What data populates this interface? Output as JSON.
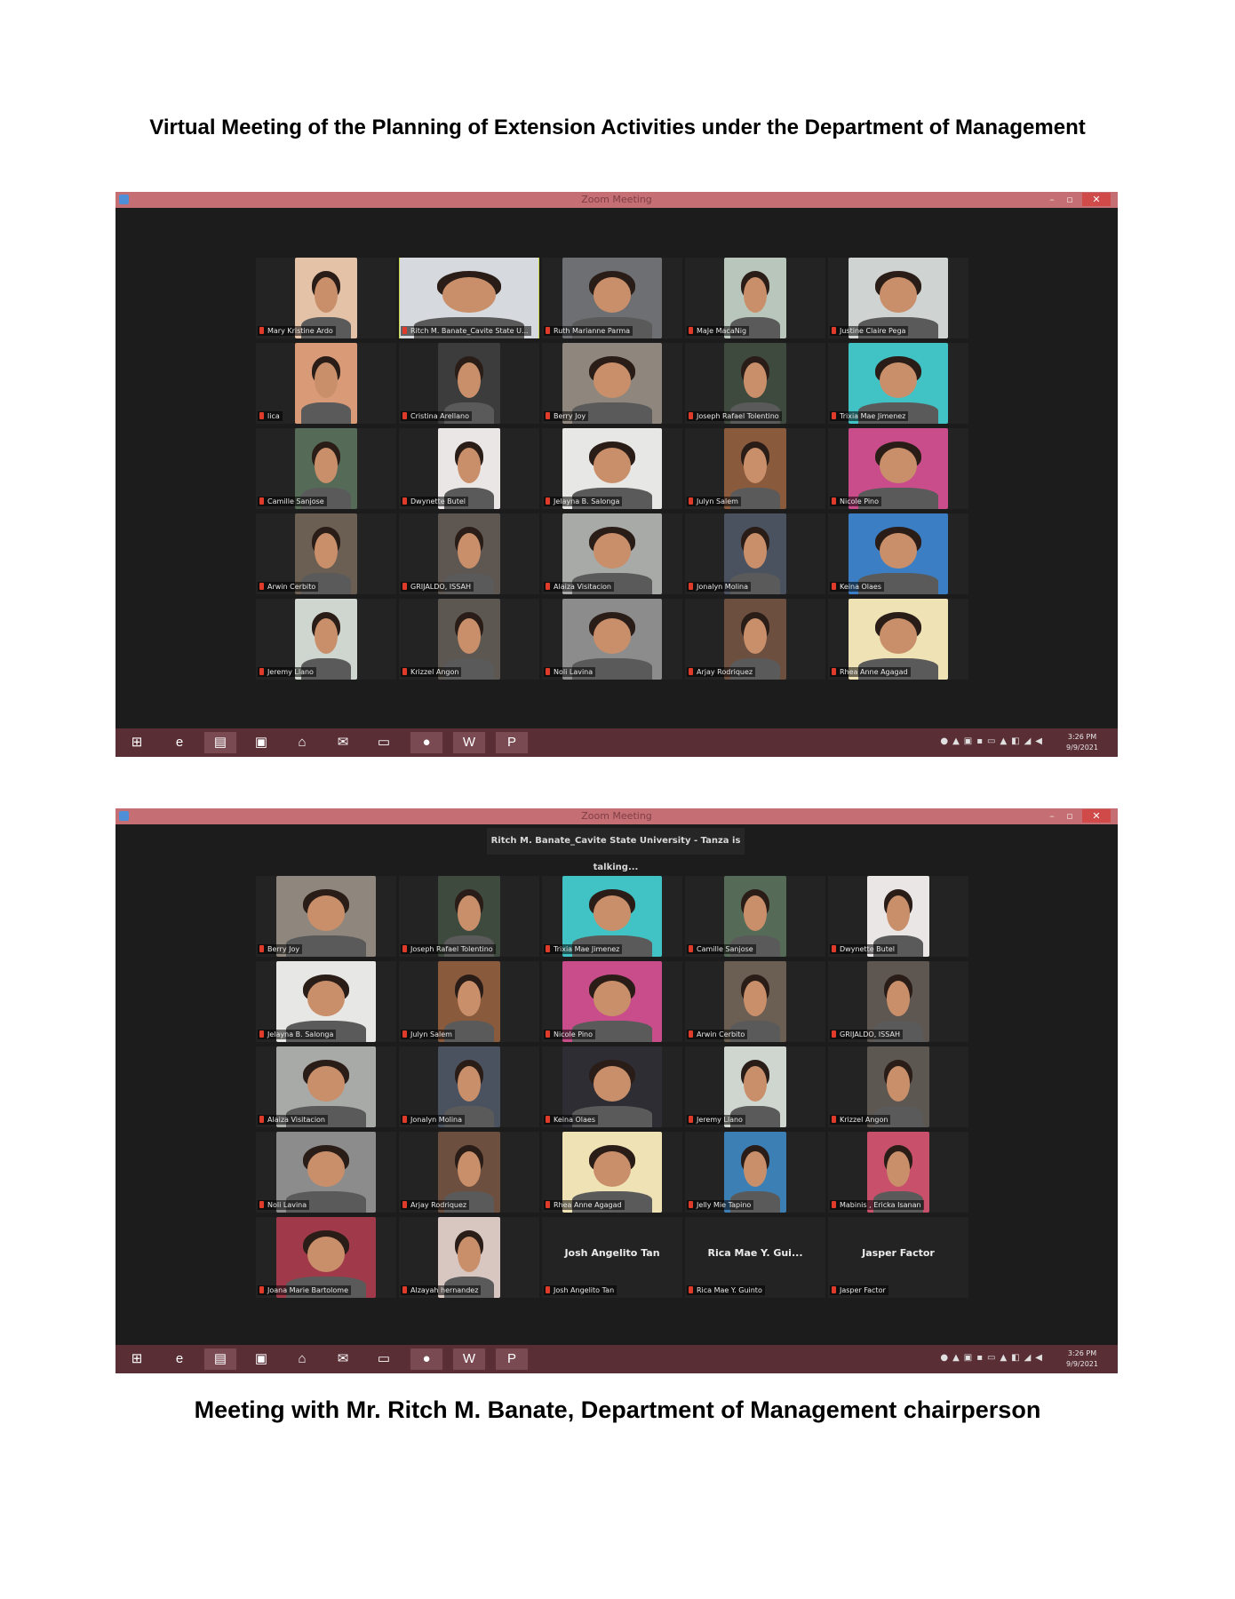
{
  "document": {
    "title_top": "Virtual Meeting of the Planning of Extension Activities under the Department of Management",
    "title_bottom": "Meeting with Mr. Ritch M. Banate, Department of Management chairperson"
  },
  "screenshots": [
    {
      "window_title": "Zoom Meeting",
      "talking_banner": "",
      "participants": [
        {
          "name": "Mary Kristine Ardo",
          "bg": "#e4c2a8"
        },
        {
          "name": "Ritch M. Banate_Cavite State U...",
          "bg": "#d6d9dd",
          "active": true
        },
        {
          "name": "Ruth Marianne Parma",
          "bg": "#6d6f73"
        },
        {
          "name": "MaJe MacaNig",
          "bg": "#b9c6bb"
        },
        {
          "name": "Justine Claire Pega",
          "bg": "#cfd3d1"
        },
        {
          "name": "lica",
          "bg": "#d99a78"
        },
        {
          "name": "Cristina Arellano",
          "bg": "#3c3c3c"
        },
        {
          "name": "Berry Joy",
          "bg": "#8f877d"
        },
        {
          "name": "Joseph Rafael Tolentino",
          "bg": "#3f4a3f"
        },
        {
          "name": "Trixia Mae Jimenez",
          "bg": "#41c2c4"
        },
        {
          "name": "Camille Sanjose",
          "bg": "#556b57"
        },
        {
          "name": "Dwynette Butel",
          "bg": "#eae6e6"
        },
        {
          "name": "Jelayna B. Salonga",
          "bg": "#e7e7e5"
        },
        {
          "name": "Julyn Salem",
          "bg": "#8a5a3d"
        },
        {
          "name": "Nicole Pino",
          "bg": "#c94d8a"
        },
        {
          "name": "Arwin Cerbito",
          "bg": "#6b5e52"
        },
        {
          "name": "GRIJALDO, ISSAH",
          "bg": "#5e5650"
        },
        {
          "name": "Alaiza Visitacion",
          "bg": "#a8aaa8"
        },
        {
          "name": "Jonalyn Molina",
          "bg": "#4a5260"
        },
        {
          "name": "Keina Olaes",
          "bg": "#3b7ec4"
        },
        {
          "name": "Jeremy Llano",
          "bg": "#cfd6cf"
        },
        {
          "name": "Krizzel Angon",
          "bg": "#5c5750"
        },
        {
          "name": "Noli Lavina",
          "bg": "#8c8c8c"
        },
        {
          "name": "Arjay Rodriquez",
          "bg": "#6d4f3f"
        },
        {
          "name": "Rhea Anne Agagad",
          "bg": "#efe3b6"
        }
      ],
      "taskbar_time": "3:26 PM",
      "taskbar_date": "9/9/2021"
    },
    {
      "window_title": "Zoom Meeting",
      "talking_banner": "Ritch M. Banate_Cavite State University - Tanza is talking...",
      "participants": [
        {
          "name": "Berry Joy",
          "bg": "#8f877d"
        },
        {
          "name": "Joseph Rafael Tolentino",
          "bg": "#3f4a3f"
        },
        {
          "name": "Trixia Mae Jimenez",
          "bg": "#41c2c4"
        },
        {
          "name": "Camille Sanjose",
          "bg": "#556b57"
        },
        {
          "name": "Dwynette Butel",
          "bg": "#eae6e6"
        },
        {
          "name": "Jelayna B. Salonga",
          "bg": "#e7e7e5"
        },
        {
          "name": "Julyn Salem",
          "bg": "#8a5a3d"
        },
        {
          "name": "Nicole Pino",
          "bg": "#c94d8a"
        },
        {
          "name": "Arwin Cerbito",
          "bg": "#6b5e52"
        },
        {
          "name": "GRIJALDO, ISSAH",
          "bg": "#5e5650"
        },
        {
          "name": "Alaiza Visitacion",
          "bg": "#a8aaa8"
        },
        {
          "name": "Jonalyn Molina",
          "bg": "#4a5260"
        },
        {
          "name": "Keina Olaes",
          "bg": "#2d2d33"
        },
        {
          "name": "Jeremy Llano",
          "bg": "#cfd6cf"
        },
        {
          "name": "Krizzel Angon",
          "bg": "#5c5750"
        },
        {
          "name": "Noli Lavina",
          "bg": "#8c8c8c"
        },
        {
          "name": "Arjay Rodriquez",
          "bg": "#6d4f3f"
        },
        {
          "name": "Rhea Anne Agagad",
          "bg": "#efe3b6"
        },
        {
          "name": "Jelly Mie Tapino",
          "bg": "#3c7fb5"
        },
        {
          "name": "Mabinis , Ericka Isanan",
          "bg": "#c8506a"
        },
        {
          "name": "Joana Marie Bartolome",
          "bg": "#a03a4a"
        },
        {
          "name": "Alzayah hernandez",
          "bg": "#d8c6c0"
        },
        {
          "name": "Josh Angelito Tan",
          "video_off_name": "Josh Angelito Tan"
        },
        {
          "name": "Rica Mae Y. Guinto",
          "video_off_name": "Rica Mae Y. Gui..."
        },
        {
          "name": "Jasper Factor",
          "video_off_name": "Jasper Factor"
        }
      ],
      "taskbar_time": "3:26 PM",
      "taskbar_date": "9/9/2021"
    }
  ],
  "taskbar_icons": [
    "windows-start-icon",
    "internet-explorer-icon",
    "file-explorer-icon",
    "store-icon",
    "home-icon",
    "mail-icon",
    "desktop-icon",
    "zoom-icon",
    "word-icon",
    "powerpoint-icon"
  ],
  "colors": {
    "titlebar": "#c56f74",
    "taskbar": "#5a2e35",
    "meeting_bg": "#1c1c1c",
    "active_speaker": "#c8d84a"
  }
}
